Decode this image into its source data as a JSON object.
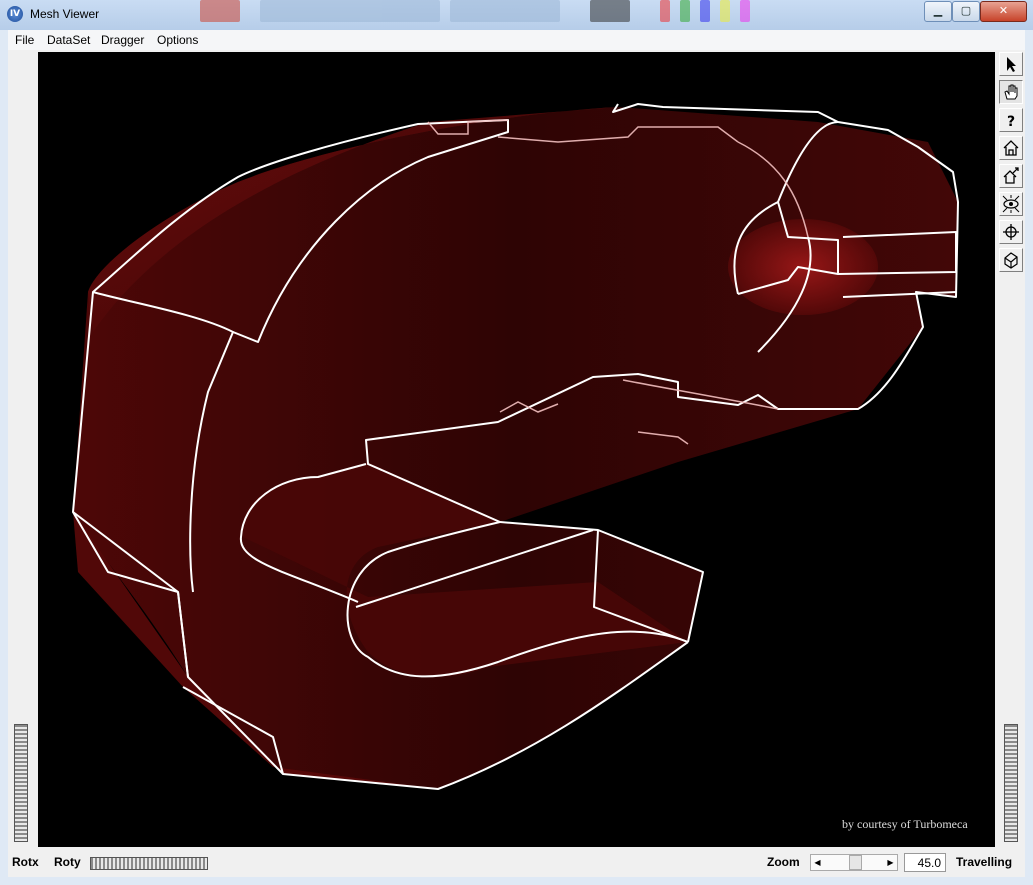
{
  "window": {
    "title": "Mesh Viewer",
    "app_icon_glyph": "IV"
  },
  "menu": [
    "File",
    "DataSet",
    "Dragger",
    "Options"
  ],
  "viewport": {
    "credit": "by courtesy of Turbomeca",
    "background": "#000000",
    "mesh_color": "#3b0606",
    "edge_color": "#ffffff"
  },
  "toolbar": [
    {
      "name": "select-arrow-icon",
      "pressed": false
    },
    {
      "name": "hand-view-icon",
      "pressed": true
    },
    {
      "name": "help-question-icon",
      "pressed": false
    },
    {
      "name": "home-icon",
      "pressed": false
    },
    {
      "name": "set-home-icon",
      "pressed": false
    },
    {
      "name": "view-all-eye-icon",
      "pressed": false
    },
    {
      "name": "seek-crosshair-icon",
      "pressed": false
    },
    {
      "name": "perspective-cube-icon",
      "pressed": false
    }
  ],
  "bottom": {
    "rotx": "Rotx",
    "roty": "Roty",
    "zoom": "Zoom",
    "zoom_value": "45.0",
    "travelling": "Travelling"
  }
}
